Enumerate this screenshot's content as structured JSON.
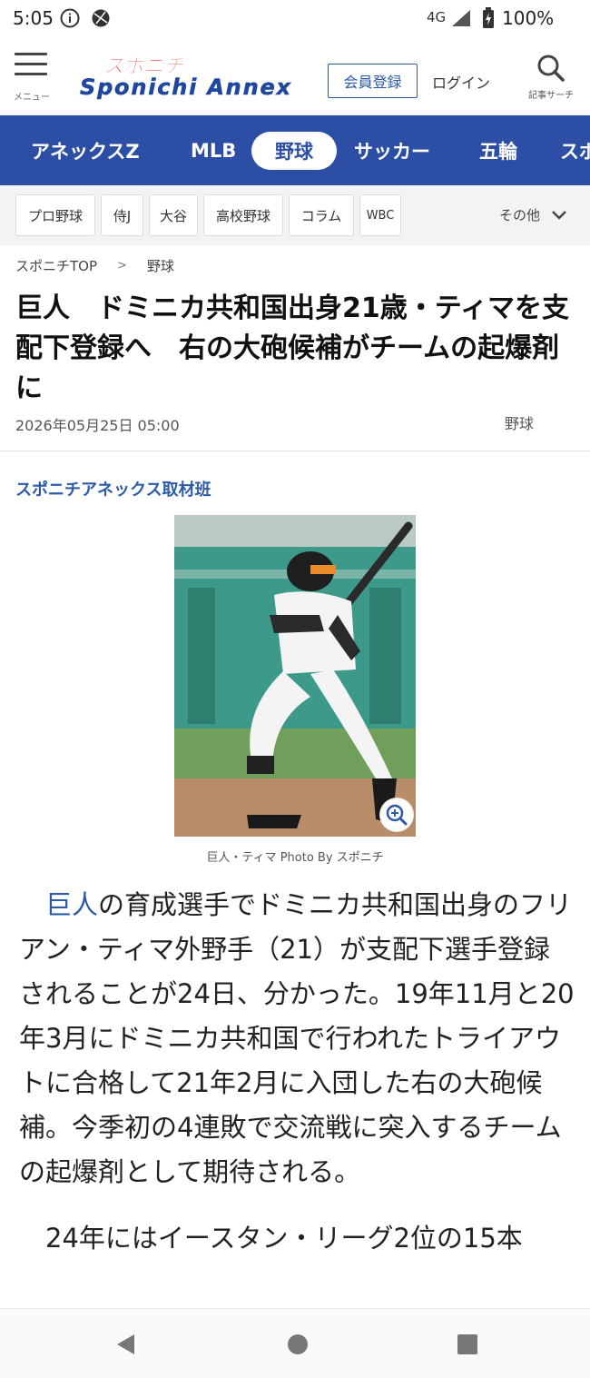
{
  "status": {
    "time": "5:05",
    "network": "4G",
    "battery": "100%"
  },
  "header": {
    "menu_label": "メニュー",
    "logo_top": "スポニチ",
    "logo_bottom": "Sponichi Annex",
    "member_label": "会員登録",
    "login_label": "ログイン",
    "search_label": "記事サーチ"
  },
  "nav": {
    "items": [
      "アネックスZ",
      "MLB",
      "野球",
      "サッカー",
      "五輪",
      "スポ"
    ],
    "active": "野球"
  },
  "subnav": {
    "chips": [
      "プロ野球",
      "侍J",
      "大谷",
      "高校野球",
      "コラム",
      "WBC"
    ],
    "more_label": "その他"
  },
  "breadcrumb": {
    "home": "スポニチTOP",
    "separator": ">",
    "current": "野球"
  },
  "article": {
    "title": "巨人　ドミニカ共和国出身21歳・ティマを支配下登録へ　右の大砲候補がチームの起爆剤に",
    "date": "2026年05月25日 05:00",
    "category": "野球",
    "author": "スポニチアネックス取材班",
    "photo_caption": "巨人・ティマ Photo By スポニチ",
    "lead_link": "巨人",
    "paragraph1_rest": "の育成選手でドミニカ共和国出身のフリアン・ティマ外野手（21）が支配下選手登録されることが24日、分かった。19年11月と20年3月にドミニカ共和国で行われたトライアウトに合格して21年2月に入団した右の大砲候補。今季初の4連敗で交流戦に突入するチームの起爆剤として期待される。",
    "paragraph2": "24年にはイースタン・リーグ2位の15本"
  }
}
